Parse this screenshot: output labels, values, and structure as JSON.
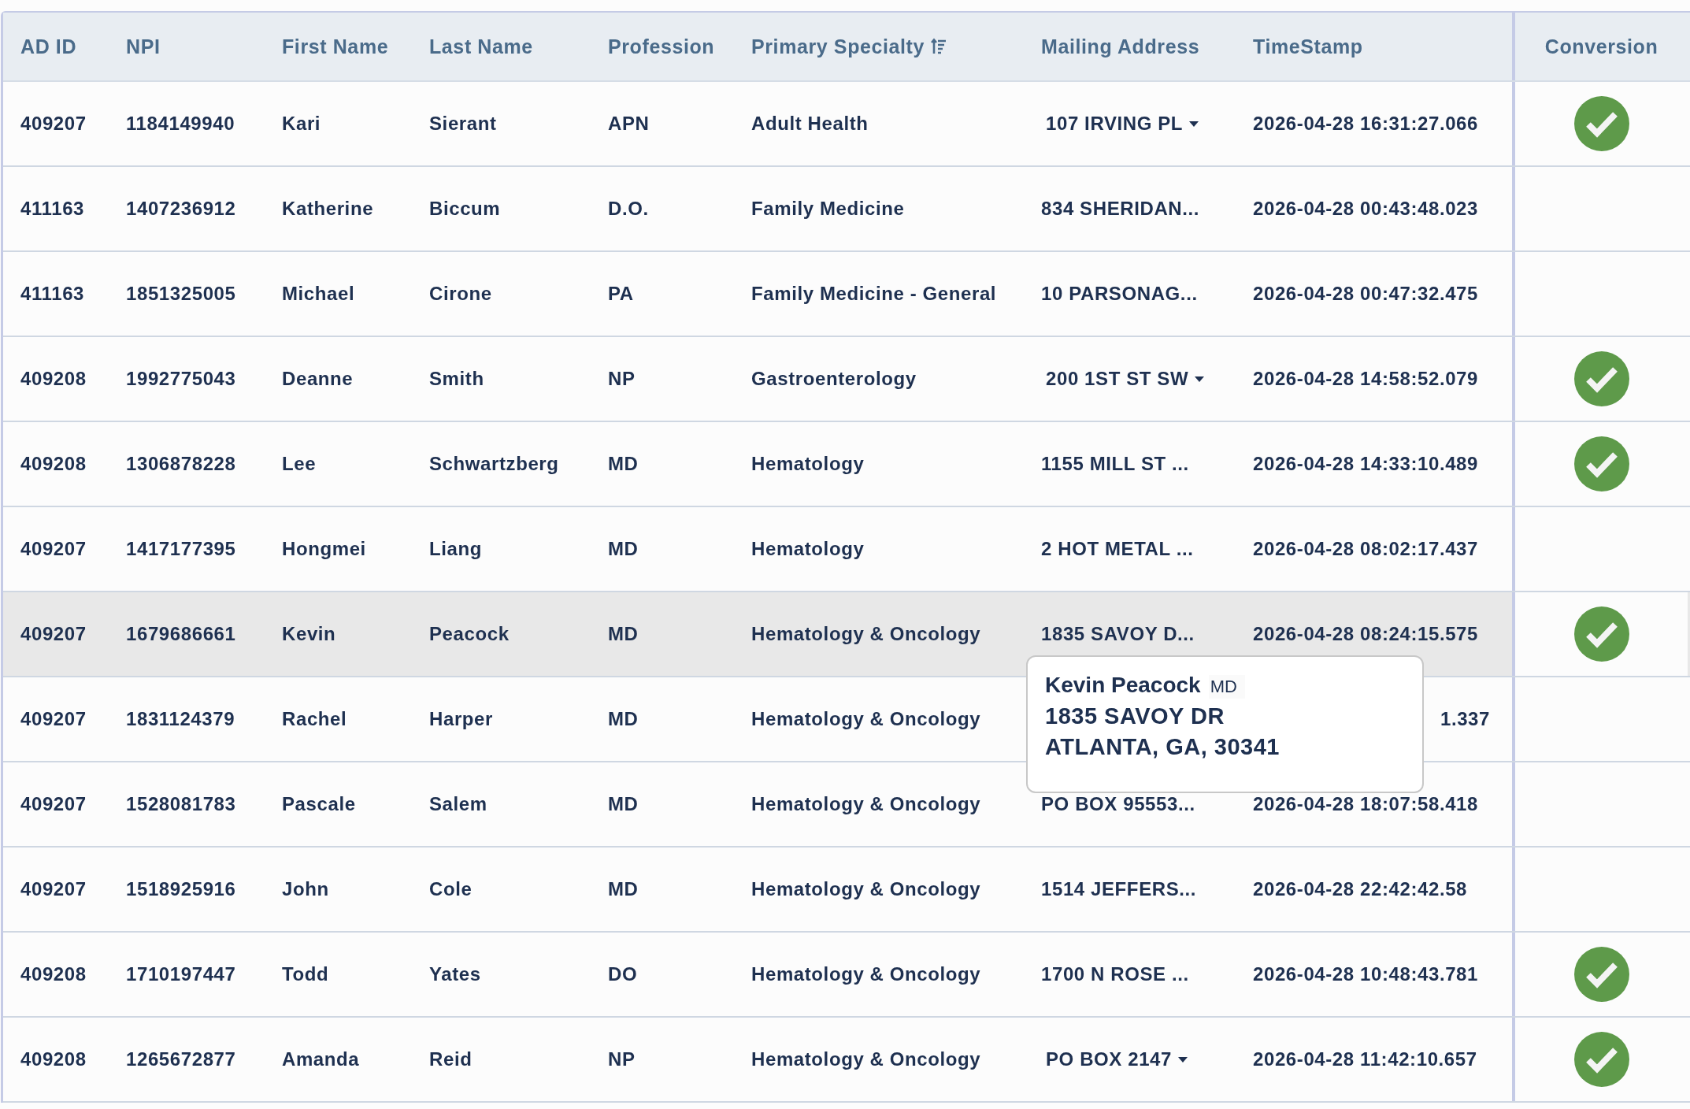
{
  "table": {
    "columns": [
      {
        "label": "AD ID"
      },
      {
        "label": "NPI"
      },
      {
        "label": "First Name"
      },
      {
        "label": "Last Name"
      },
      {
        "label": "Profession"
      },
      {
        "label": "Primary Specialty",
        "sorted": true
      },
      {
        "label": "Mailing Address"
      },
      {
        "label": "TimeStamp"
      },
      {
        "label": "Conversion"
      }
    ],
    "rows": [
      {
        "ad_id": "409207",
        "npi": "1184149940",
        "first_name": "Kari",
        "last_name": "Sierant",
        "profession": "APN",
        "specialty": "Adult Health",
        "address": "107 IRVING PL",
        "address_dropdown": true,
        "timestamp": "2026-04-28 16:31:27.066",
        "converted": true,
        "hovered": false
      },
      {
        "ad_id": "411163",
        "npi": "1407236912",
        "first_name": "Katherine",
        "last_name": "Biccum",
        "profession": "D.O.",
        "specialty": "Family Medicine",
        "address": "834 SHERIDAN...",
        "address_dropdown": false,
        "timestamp": "2026-04-28 00:43:48.023",
        "converted": false,
        "hovered": false
      },
      {
        "ad_id": "411163",
        "npi": "1851325005",
        "first_name": "Michael",
        "last_name": "Cirone",
        "profession": "PA",
        "specialty": "Family Medicine - General",
        "address": "10 PARSONAG...",
        "address_dropdown": false,
        "timestamp": "2026-04-28 00:47:32.475",
        "converted": false,
        "hovered": false
      },
      {
        "ad_id": "409208",
        "npi": "1992775043",
        "first_name": "Deanne",
        "last_name": "Smith",
        "profession": "NP",
        "specialty": "Gastroenterology",
        "address": "200 1ST ST SW",
        "address_dropdown": true,
        "timestamp": "2026-04-28 14:58:52.079",
        "converted": true,
        "hovered": false
      },
      {
        "ad_id": "409208",
        "npi": "1306878228",
        "first_name": "Lee",
        "last_name": "Schwartzberg",
        "profession": "MD",
        "specialty": "Hematology",
        "address": "1155 MILL ST ...",
        "address_dropdown": false,
        "timestamp": "2026-04-28 14:33:10.489",
        "converted": true,
        "hovered": false
      },
      {
        "ad_id": "409207",
        "npi": "1417177395",
        "first_name": "Hongmei",
        "last_name": "Liang",
        "profession": "MD",
        "specialty": "Hematology",
        "address": "2 HOT METAL ...",
        "address_dropdown": false,
        "timestamp": "2026-04-28 08:02:17.437",
        "converted": false,
        "hovered": false
      },
      {
        "ad_id": "409207",
        "npi": "1679686661",
        "first_name": "Kevin",
        "last_name": "Peacock",
        "profession": "MD",
        "specialty": "Hematology & Oncology",
        "address": "1835 SAVOY D...",
        "address_dropdown": false,
        "timestamp": "2026-04-28 08:24:15.575",
        "converted": true,
        "hovered": true
      },
      {
        "ad_id": "409207",
        "npi": "1831124379",
        "first_name": "Rachel",
        "last_name": "Harper",
        "profession": "MD",
        "specialty": "Hematology & Oncology",
        "timestamp": "1.337",
        "timestamp_partial": true,
        "converted": false,
        "hovered": false
      },
      {
        "ad_id": "409207",
        "npi": "1528081783",
        "first_name": "Pascale",
        "last_name": "Salem",
        "profession": "MD",
        "specialty": "Hematology & Oncology",
        "address": "PO BOX 95553...",
        "address_dropdown": false,
        "timestamp": "2026-04-28 18:07:58.418",
        "converted": false,
        "hovered": false
      },
      {
        "ad_id": "409207",
        "npi": "1518925916",
        "first_name": "John",
        "last_name": "Cole",
        "profession": "MD",
        "specialty": "Hematology & Oncology",
        "address": "1514 JEFFERS...",
        "address_dropdown": false,
        "timestamp": "2026-04-28 22:42:42.58",
        "converted": false,
        "hovered": false
      },
      {
        "ad_id": "409208",
        "npi": "1710197447",
        "first_name": "Todd",
        "last_name": "Yates",
        "profession": "DO",
        "specialty": "Hematology & Oncology",
        "address": "1700 N ROSE ...",
        "address_dropdown": false,
        "timestamp": "2026-04-28 10:48:43.781",
        "converted": true,
        "hovered": false
      },
      {
        "ad_id": "409208",
        "npi": "1265672877",
        "first_name": "Amanda",
        "last_name": "Reid",
        "profession": "NP",
        "specialty": "Hematology & Oncology",
        "address": "PO BOX 2147",
        "address_dropdown": true,
        "timestamp": "2026-04-28 11:42:10.657",
        "converted": true,
        "hovered": false
      }
    ]
  },
  "tooltip": {
    "name": "Kevin Peacock",
    "profession": "MD",
    "address_line_1": "1835 SAVOY DR",
    "address_line_2": "ATLANTA, GA, 30341"
  }
}
